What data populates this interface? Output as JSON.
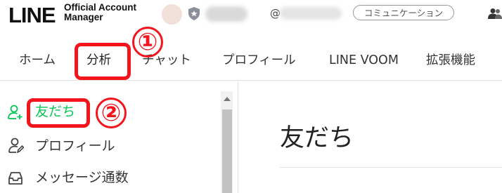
{
  "header": {
    "brand": "LINE",
    "brand_sub_line1": "Official Account",
    "brand_sub_line2": "Manager",
    "account_id_prefix": "@",
    "plan_badge": "コミュニケーション"
  },
  "nav": {
    "items": [
      {
        "label": "ホーム"
      },
      {
        "label": "分析"
      },
      {
        "label": "チャット"
      },
      {
        "label": "プロフィール"
      },
      {
        "label": "LINE VOOM"
      },
      {
        "label": "拡張機能"
      }
    ],
    "active": "分析"
  },
  "sidebar": {
    "items": [
      {
        "label": "友だち",
        "icon": "add-friend-icon",
        "active": true
      },
      {
        "label": "プロフィール",
        "icon": "profile-icon",
        "active": false
      },
      {
        "label": "メッセージ通数",
        "icon": "inbox-icon",
        "active": false
      }
    ]
  },
  "main": {
    "title": "友だち"
  },
  "annotations": {
    "step1": "①",
    "step2": "②"
  },
  "colors": {
    "accent": "#06c755",
    "annotation": "#f4151c"
  }
}
